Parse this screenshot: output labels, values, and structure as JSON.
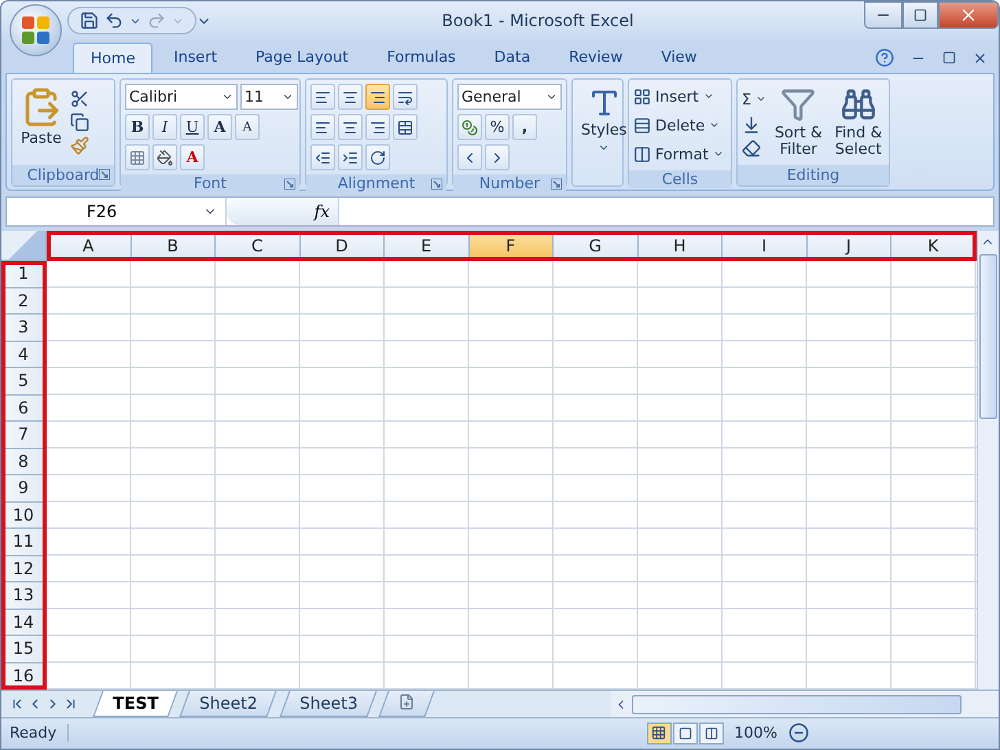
{
  "window": {
    "title": "Book1 - Microsoft Excel"
  },
  "ribbon_tabs": [
    {
      "label": "Home",
      "selected": true
    },
    {
      "label": "Insert",
      "selected": false
    },
    {
      "label": "Page Layout",
      "selected": false
    },
    {
      "label": "Formulas",
      "selected": false
    },
    {
      "label": "Data",
      "selected": false
    },
    {
      "label": "Review",
      "selected": false
    },
    {
      "label": "View",
      "selected": false
    }
  ],
  "clipboard": {
    "paste": "Paste",
    "label": "Clipboard"
  },
  "font": {
    "name": "Calibri",
    "size": "11",
    "bold": "B",
    "italic": "I",
    "underline": "U",
    "grow": "A",
    "shrink": "A",
    "color_button": "A",
    "label": "Font"
  },
  "alignment": {
    "label": "Alignment"
  },
  "number": {
    "format": "General",
    "percent": "%",
    "comma": ",",
    "label": "Number"
  },
  "styles": {
    "label": "Styles"
  },
  "cells": {
    "items": [
      "Insert",
      "Delete",
      "Format"
    ],
    "label": "Cells"
  },
  "editing": {
    "sum": "Σ",
    "sort": [
      "Sort &",
      "Filter"
    ],
    "find": [
      "Find &",
      "Select"
    ],
    "label": "Editing"
  },
  "formula_bar": {
    "name_box": "F26",
    "fx": "fx"
  },
  "column_headers": {
    "highlighted": true,
    "items": [
      {
        "label": "A",
        "selected": false
      },
      {
        "label": "B",
        "selected": false
      },
      {
        "label": "C",
        "selected": false
      },
      {
        "label": "D",
        "selected": false
      },
      {
        "label": "E",
        "selected": false
      },
      {
        "label": "F",
        "selected": true
      },
      {
        "label": "G",
        "selected": false
      },
      {
        "label": "H",
        "selected": false
      },
      {
        "label": "I",
        "selected": false
      },
      {
        "label": "J",
        "selected": false
      },
      {
        "label": "K",
        "selected": false
      }
    ]
  },
  "row_headers": {
    "highlighted": true,
    "items": [
      "1",
      "2",
      "3",
      "4",
      "5",
      "6",
      "7",
      "8",
      "9",
      "10",
      "11",
      "12",
      "13",
      "14",
      "15",
      "16"
    ]
  },
  "sheet_tabs": [
    {
      "label": "TEST",
      "selected": true
    },
    {
      "label": "Sheet2",
      "selected": false
    },
    {
      "label": "Sheet3",
      "selected": false
    }
  ],
  "status_bar": {
    "status": "Ready",
    "zoom": "100%"
  }
}
